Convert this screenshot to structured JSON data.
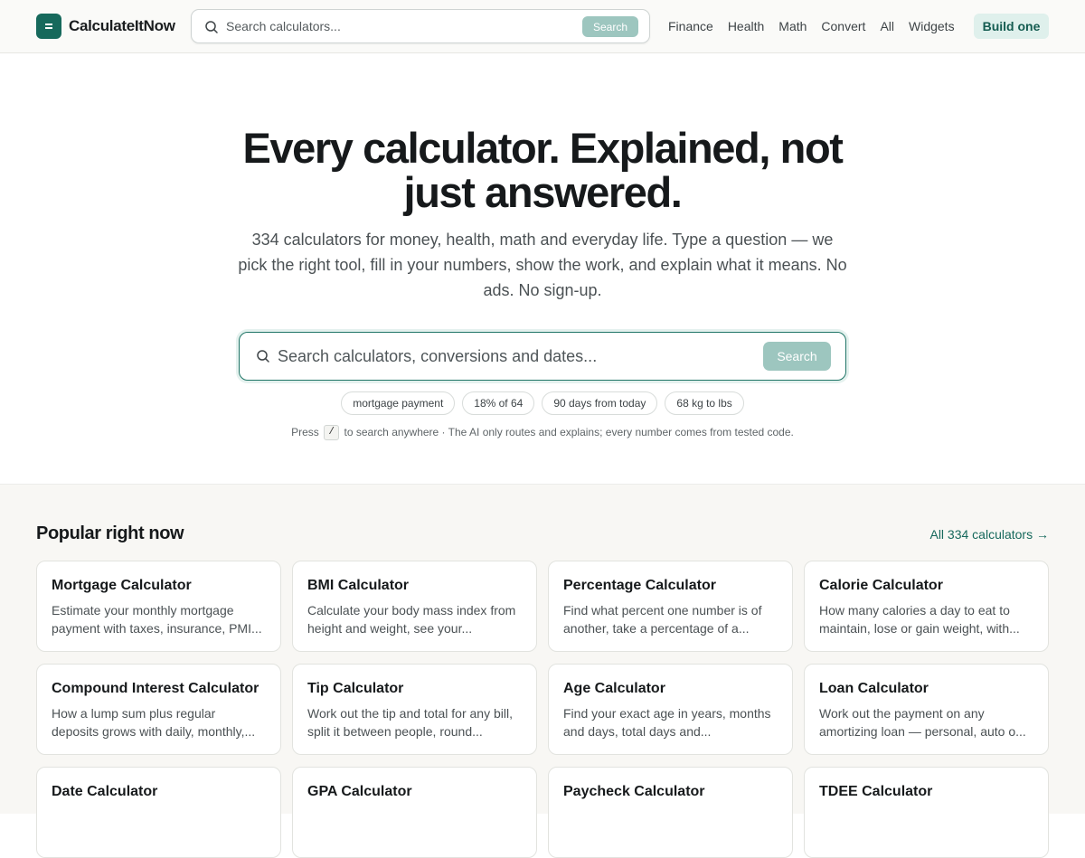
{
  "header": {
    "brand": "CalculateItNow",
    "search_placeholder": "Search calculators...",
    "search_button": "Search",
    "nav": [
      "Finance",
      "Health",
      "Math",
      "Convert",
      "All",
      "Widgets"
    ],
    "build_button": "Build one"
  },
  "hero": {
    "title": "Every calculator. Explained, not just answered.",
    "subtitle": "334 calculators for money, health, math and everyday life. Type a question — we pick the right tool, fill in your numbers, show the work, and explain what it means. No ads. No sign-up.",
    "search_placeholder": "Search calculators, conversions and dates...",
    "search_button": "Search",
    "chips": [
      "mortgage payment",
      "18% of 64",
      "90 days from today",
      "68 kg to lbs"
    ],
    "hint_before": "Press",
    "hint_key": "/",
    "hint_after": "to search anywhere · The AI only routes and explains; every number comes from tested code."
  },
  "popular": {
    "title": "Popular right now",
    "all_link": "All 334 calculators →",
    "cards": [
      {
        "title": "Mortgage Calculator",
        "desc": "Estimate your monthly mortgage payment with taxes, insurance, PMI..."
      },
      {
        "title": "BMI Calculator",
        "desc": "Calculate your body mass index from height and weight, see your..."
      },
      {
        "title": "Percentage Calculator",
        "desc": "Find what percent one number is of another, take a percentage of a..."
      },
      {
        "title": "Calorie Calculator",
        "desc": "How many calories a day to eat to maintain, lose or gain weight, with..."
      },
      {
        "title": "Compound Interest Calculator",
        "desc": "How a lump sum plus regular deposits grows with daily, monthly,..."
      },
      {
        "title": "Tip Calculator",
        "desc": "Work out the tip and total for any bill, split it between people, round..."
      },
      {
        "title": "Age Calculator",
        "desc": "Find your exact age in years, months and days, total days and..."
      },
      {
        "title": "Loan Calculator",
        "desc": "Work out the payment on any amortizing loan — personal, auto o..."
      },
      {
        "title": "Date Calculator",
        "desc": ""
      },
      {
        "title": "GPA Calculator",
        "desc": ""
      },
      {
        "title": "Paycheck Calculator",
        "desc": ""
      },
      {
        "title": "TDEE Calculator",
        "desc": ""
      }
    ]
  }
}
